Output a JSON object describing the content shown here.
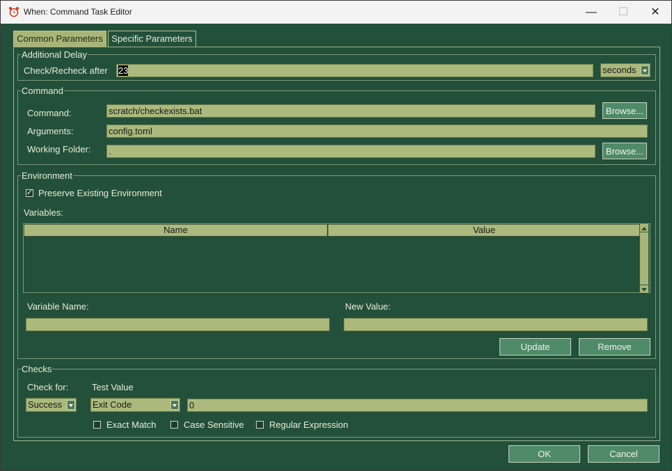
{
  "window": {
    "title": "When: Command Task Editor",
    "icon": "alarm-clock-icon",
    "minimize": "—",
    "maximize": "☐",
    "close": "✕"
  },
  "tabs": [
    {
      "label": "Common Parameters",
      "active": true
    },
    {
      "label": "Specific Parameters",
      "active": false
    }
  ],
  "additional_delay": {
    "legend": "Additional Delay",
    "label": "Check/Recheck after",
    "value": "23",
    "unit": "seconds"
  },
  "command": {
    "legend": "Command",
    "command_label": "Command:",
    "command_value": "scratch/checkexists.bat",
    "arguments_label": "Arguments:",
    "arguments_value": "config.toml",
    "folder_label": "Working Folder:",
    "folder_value": ".",
    "browse_label": "Browse..."
  },
  "environment": {
    "legend": "Environment",
    "preserve_label": "Preserve Existing Environment",
    "preserve_checked": true,
    "variables_label": "Variables:",
    "columns": [
      "Name",
      "Value"
    ],
    "variable_name_label": "Variable Name:",
    "new_value_label": "New Value:",
    "variable_name_value": "",
    "new_value_value": "",
    "update_label": "Update",
    "remove_label": "Remove"
  },
  "checks": {
    "legend": "Checks",
    "check_for_label": "Check for:",
    "check_for_value": "Success",
    "test_value_label": "Test Value",
    "test_type": "Exit Code",
    "test_value": "0",
    "exact_match": "Exact Match",
    "case_sensitive": "Case Sensitive",
    "regular_expression": "Regular Expression"
  },
  "footer": {
    "ok_label": "OK",
    "cancel_label": "Cancel"
  },
  "colors": {
    "background": "#23503a",
    "field": "#abb97c",
    "button": "#4f8a69"
  }
}
